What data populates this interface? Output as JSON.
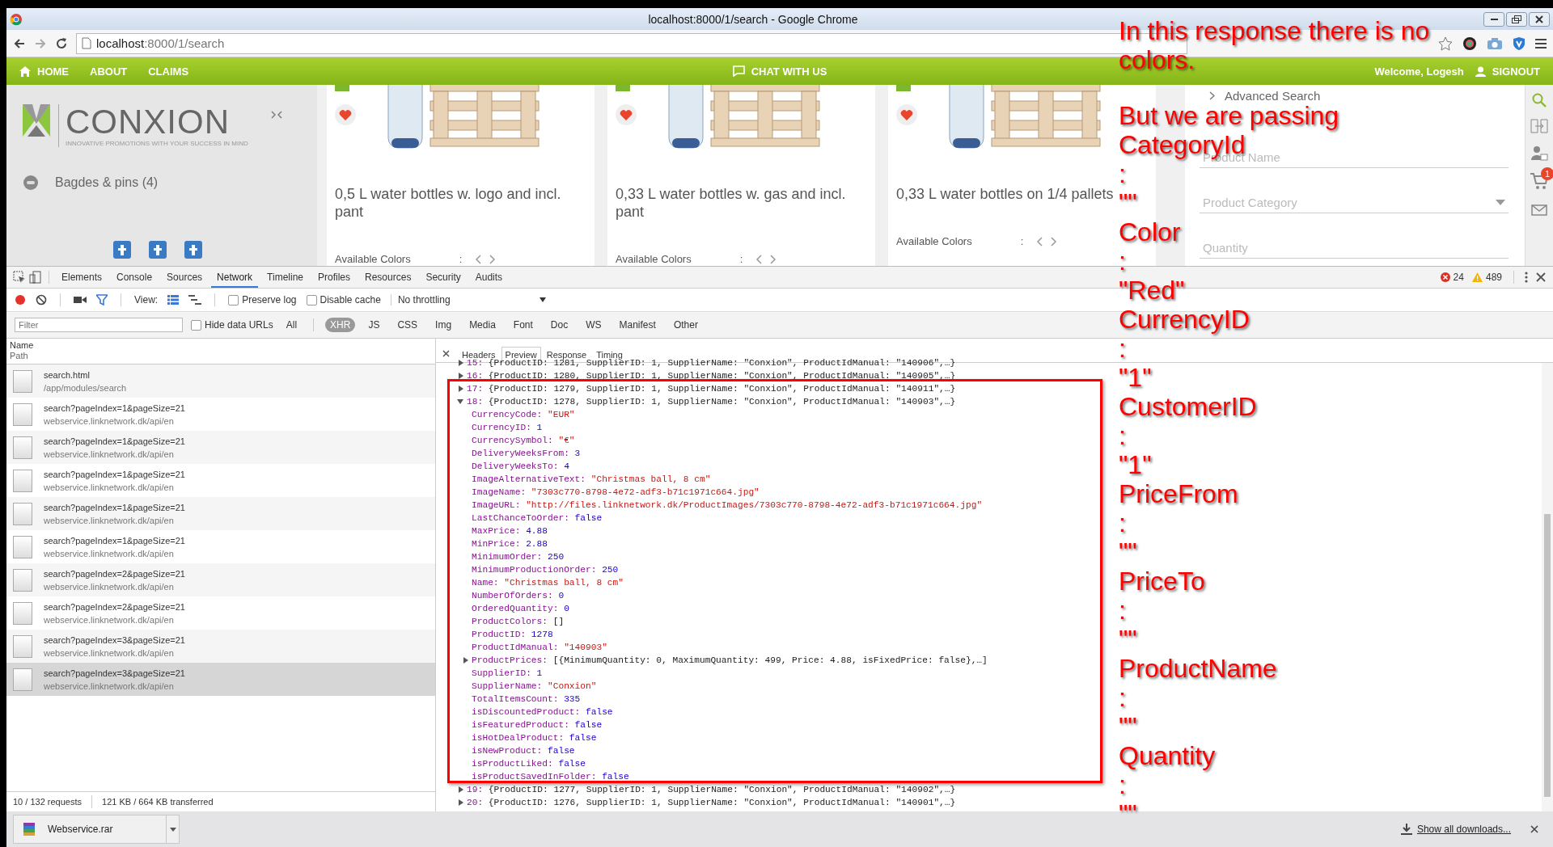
{
  "window": {
    "title": "localhost:8000/1/search - Google Chrome"
  },
  "address_bar": {
    "host": "localhost",
    "path": ":8000/1/search"
  },
  "site": {
    "nav": [
      {
        "label": "HOME",
        "has_icon": true
      },
      {
        "label": "ABOUT",
        "has_icon": false
      },
      {
        "label": "CLAIMS",
        "has_icon": false
      }
    ],
    "chat": "CHAT WITH US",
    "welcome": "Welcome, Logesh",
    "signout": "SIGNOUT",
    "logo": {
      "name": "CONXION",
      "tagline": "INNOVATIVE PROMOTIONS WITH YOUR SUCCESS IN MIND"
    },
    "categories": [
      "Bagdes & pins (4)"
    ],
    "products": [
      {
        "title": "0,5 L water bottles w. logo and incl. pant",
        "colors_label": "Available Colors",
        "separator": ":"
      },
      {
        "title": "0,33 L water bottles w. gas and incl. pant",
        "colors_label": "Available Colors",
        "separator": ":"
      },
      {
        "title": "0,33 L water bottles on 1/4 pallets",
        "colors_label": "Available Colors",
        "separator": ":"
      }
    ],
    "advanced_search": {
      "title": "Advanced Search",
      "fields": [
        {
          "kind": "text",
          "placeholder": "Product Name"
        },
        {
          "kind": "select",
          "placeholder": "Product Category"
        },
        {
          "kind": "text",
          "placeholder": "Quantity"
        }
      ]
    },
    "cart_badge": "1"
  },
  "devtools": {
    "tabs": [
      {
        "label": "Elements",
        "selected": false
      },
      {
        "label": "Console",
        "selected": false
      },
      {
        "label": "Sources",
        "selected": false
      },
      {
        "label": "Network",
        "selected": true
      },
      {
        "label": "Timeline",
        "selected": false
      },
      {
        "label": "Profiles",
        "selected": false
      },
      {
        "label": "Resources",
        "selected": false
      },
      {
        "label": "Security",
        "selected": false
      },
      {
        "label": "Audits",
        "selected": false
      }
    ],
    "errors": "24",
    "warnings": "489",
    "view_label": "View:",
    "checkboxes": [
      {
        "label": "Preserve log",
        "checked": false
      },
      {
        "label": "Disable cache",
        "checked": false
      }
    ],
    "throttling": "No throttling",
    "filter": {
      "placeholder": "Filter",
      "hide_data_urls": {
        "label": "Hide data URLs",
        "checked": false
      }
    },
    "types": [
      {
        "label": "All",
        "selected": false
      },
      {
        "label": "XHR",
        "selected": true
      },
      {
        "label": "JS",
        "selected": false
      },
      {
        "label": "CSS",
        "selected": false
      },
      {
        "label": "Img",
        "selected": false
      },
      {
        "label": "Media",
        "selected": false
      },
      {
        "label": "Font",
        "selected": false
      },
      {
        "label": "Doc",
        "selected": false
      },
      {
        "label": "WS",
        "selected": false
      },
      {
        "label": "Manifest",
        "selected": false
      },
      {
        "label": "Other",
        "selected": false
      }
    ],
    "columns": [
      "Name",
      "Path"
    ],
    "requests": [
      {
        "name": "search.html",
        "path": "/app/modules/search",
        "selected": false
      },
      {
        "name": "search?pageIndex=1&pageSize=21",
        "path": "webservice.linknetwork.dk/api/en",
        "selected": false
      },
      {
        "name": "search?pageIndex=1&pageSize=21",
        "path": "webservice.linknetwork.dk/api/en",
        "selected": false
      },
      {
        "name": "search?pageIndex=1&pageSize=21",
        "path": "webservice.linknetwork.dk/api/en",
        "selected": false
      },
      {
        "name": "search?pageIndex=1&pageSize=21",
        "path": "webservice.linknetwork.dk/api/en",
        "selected": false
      },
      {
        "name": "search?pageIndex=1&pageSize=21",
        "path": "webservice.linknetwork.dk/api/en",
        "selected": false
      },
      {
        "name": "search?pageIndex=2&pageSize=21",
        "path": "webservice.linknetwork.dk/api/en",
        "selected": false
      },
      {
        "name": "search?pageIndex=2&pageSize=21",
        "path": "webservice.linknetwork.dk/api/en",
        "selected": false
      },
      {
        "name": "search?pageIndex=3&pageSize=21",
        "path": "webservice.linknetwork.dk/api/en",
        "selected": false
      },
      {
        "name": "search?pageIndex=3&pageSize=21",
        "path": "webservice.linknetwork.dk/api/en",
        "selected": true
      }
    ],
    "status": {
      "requests": "10 / 132 requests",
      "transferred": "121 KB / 664 KB transferred"
    },
    "detail_tabs": [
      {
        "label": "Headers",
        "selected": false
      },
      {
        "label": "Preview",
        "selected": true
      },
      {
        "label": "Response",
        "selected": false
      },
      {
        "label": "Timing",
        "selected": false
      }
    ],
    "preview": [
      {
        "index": "15:",
        "summary": "{ProductID: 1281, SupplierID: 1, SupplierName: \"Conxion\", ProductIdManual: \"140906\",…}",
        "expanded": false
      },
      {
        "index": "16:",
        "summary": "{ProductID: 1280, SupplierID: 1, SupplierName: \"Conxion\", ProductIdManual: \"140905\",…}",
        "expanded": false
      },
      {
        "index": "17:",
        "summary": "{ProductID: 1279, SupplierID: 1, SupplierName: \"Conxion\", ProductIdManual: \"140911\",…}",
        "expanded": false
      },
      {
        "index": "18:",
        "summary": "{ProductID: 1278, SupplierID: 1, SupplierName: \"Conxion\", ProductIdManual: \"140903\",…}",
        "expanded": true,
        "children": [
          {
            "key": "CurrencyCode:",
            "value": "\"EUR\"",
            "kind": "string"
          },
          {
            "key": "CurrencyID:",
            "value": "1",
            "kind": "number"
          },
          {
            "key": "CurrencySymbol:",
            "value": "\"€\"",
            "kind": "string"
          },
          {
            "key": "DeliveryWeeksFrom:",
            "value": "3",
            "kind": "number"
          },
          {
            "key": "DeliveryWeeksTo:",
            "value": "4",
            "kind": "number"
          },
          {
            "key": "ImageAlternativeText:",
            "value": "\"Christmas ball, 8 cm\"",
            "kind": "string"
          },
          {
            "key": "ImageName:",
            "value": "\"7303c770-8798-4e72-adf3-b71c1971c664.jpg\"",
            "kind": "string"
          },
          {
            "key": "ImageURL:",
            "value": "\"http://files.linknetwork.dk/ProductImages/7303c770-8798-4e72-adf3-b71c1971c664.jpg\"",
            "kind": "string"
          },
          {
            "key": "LastChanceToOrder:",
            "value": "false",
            "kind": "boolean"
          },
          {
            "key": "MaxPrice:",
            "value": "4.88",
            "kind": "number"
          },
          {
            "key": "MinPrice:",
            "value": "2.88",
            "kind": "number"
          },
          {
            "key": "MinimumOrder:",
            "value": "250",
            "kind": "number"
          },
          {
            "key": "MinimumProductionOrder:",
            "value": "250",
            "kind": "number"
          },
          {
            "key": "Name:",
            "value": "\"Christmas ball, 8 cm\"",
            "kind": "string"
          },
          {
            "key": "NumberOfOrders:",
            "value": "0",
            "kind": "number"
          },
          {
            "key": "OrderedQuantity:",
            "value": "0",
            "kind": "number"
          },
          {
            "key": "ProductColors:",
            "value": "[]",
            "kind": "object"
          },
          {
            "key": "ProductID:",
            "value": "1278",
            "kind": "number"
          },
          {
            "key": "ProductIdManual:",
            "value": "\"140903\"",
            "kind": "string"
          },
          {
            "key": "ProductPrices:",
            "value": "[{MinimumQuantity: 0, MaximumQuantity: 499, Price: 4.88, isFixedPrice: false},…]",
            "kind": "object",
            "expanded": false
          },
          {
            "key": "SupplierID:",
            "value": "1",
            "kind": "number"
          },
          {
            "key": "SupplierName:",
            "value": "\"Conxion\"",
            "kind": "string"
          },
          {
            "key": "TotalItemsCount:",
            "value": "335",
            "kind": "number"
          },
          {
            "key": "isDiscountedProduct:",
            "value": "false",
            "kind": "boolean"
          },
          {
            "key": "isFeaturedProduct:",
            "value": "false",
            "kind": "boolean"
          },
          {
            "key": "isHotDealProduct:",
            "value": "false",
            "kind": "boolean"
          },
          {
            "key": "isNewProduct:",
            "value": "false",
            "kind": "boolean"
          },
          {
            "key": "isProductLiked:",
            "value": "false",
            "kind": "boolean"
          },
          {
            "key": "isProductSavedInFolder:",
            "value": "false",
            "kind": "boolean"
          }
        ]
      },
      {
        "index": "19:",
        "summary": "{ProductID: 1277, SupplierID: 1, SupplierName: \"Conxion\", ProductIdManual: \"140902\",…}",
        "expanded": false
      },
      {
        "index": "20:",
        "summary": "{ProductID: 1276, SupplierID: 1, SupplierName: \"Conxion\", ProductIdManual: \"140901\",…}",
        "expanded": false
      }
    ]
  },
  "downloads": {
    "file": "Webservice.rar",
    "show_all": "Show all downloads..."
  },
  "annotation": {
    "note": [
      "In this response there is no",
      "colors."
    ],
    "lines": [
      "But we are passing",
      "CategoryId",
      ":",
      "\"\"",
      "Color",
      ":",
      "\"Red\"",
      "CurrencyID",
      ":",
      "\"1\"",
      "CustomerID",
      ":",
      "\"1\"",
      "PriceFrom",
      ":",
      "\"\"",
      "PriceTo",
      ":",
      "\"\"",
      "ProductName",
      ":",
      "\"\"",
      "Quantity",
      ":",
      "\"\""
    ]
  }
}
